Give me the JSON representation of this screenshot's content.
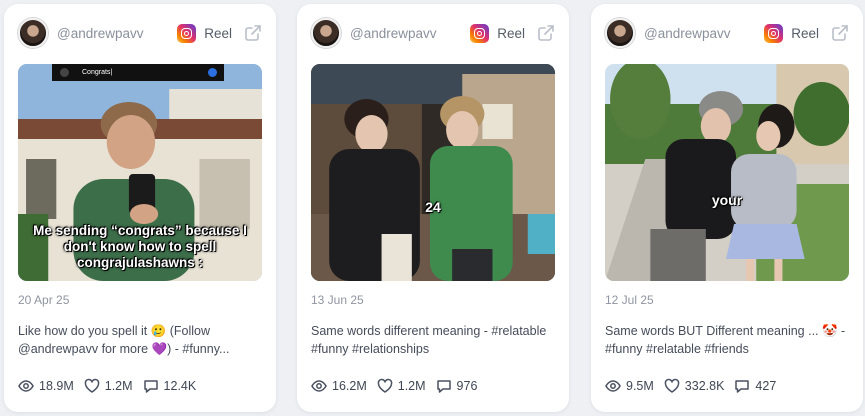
{
  "cards": [
    {
      "handle": "@andrewpavv",
      "platform_label": "Reel",
      "thumbnail_top_bar": "Congrats|",
      "thumbnail_caption": "Me sending “congrats” because I don't know how to spell congrajulashawns :",
      "date": "20 Apr 25",
      "description": "Like how do you spell it 🥲 (Follow @andrewpavv for more 💜) - #funny...",
      "views": "18.9M",
      "likes": "1.2M",
      "comments": "12.4K"
    },
    {
      "handle": "@andrewpavv",
      "platform_label": "Reel",
      "thumbnail_word": "24",
      "date": "13 Jun 25",
      "description": "Same words different meaning - #relatable #funny #relationships",
      "views": "16.2M",
      "likes": "1.2M",
      "comments": "976"
    },
    {
      "handle": "@andrewpavv",
      "platform_label": "Reel",
      "thumbnail_word": "your",
      "date": "12 Jul 25",
      "description": "Same words BUT Different meaning ... 🤡 - #funny #relatable #friends",
      "views": "9.5M",
      "likes": "332.8K",
      "comments": "427"
    }
  ],
  "colors": {
    "page_bg": "#eef0f4",
    "card_bg": "#ffffff",
    "muted_text": "#8f95a1",
    "instagram_gradient": [
      "#f9c74f",
      "#e1306c",
      "#833ab4"
    ]
  },
  "icons": [
    "avatar",
    "instagram-icon",
    "external-link-icon",
    "eye-icon",
    "heart-icon",
    "comment-icon"
  ]
}
